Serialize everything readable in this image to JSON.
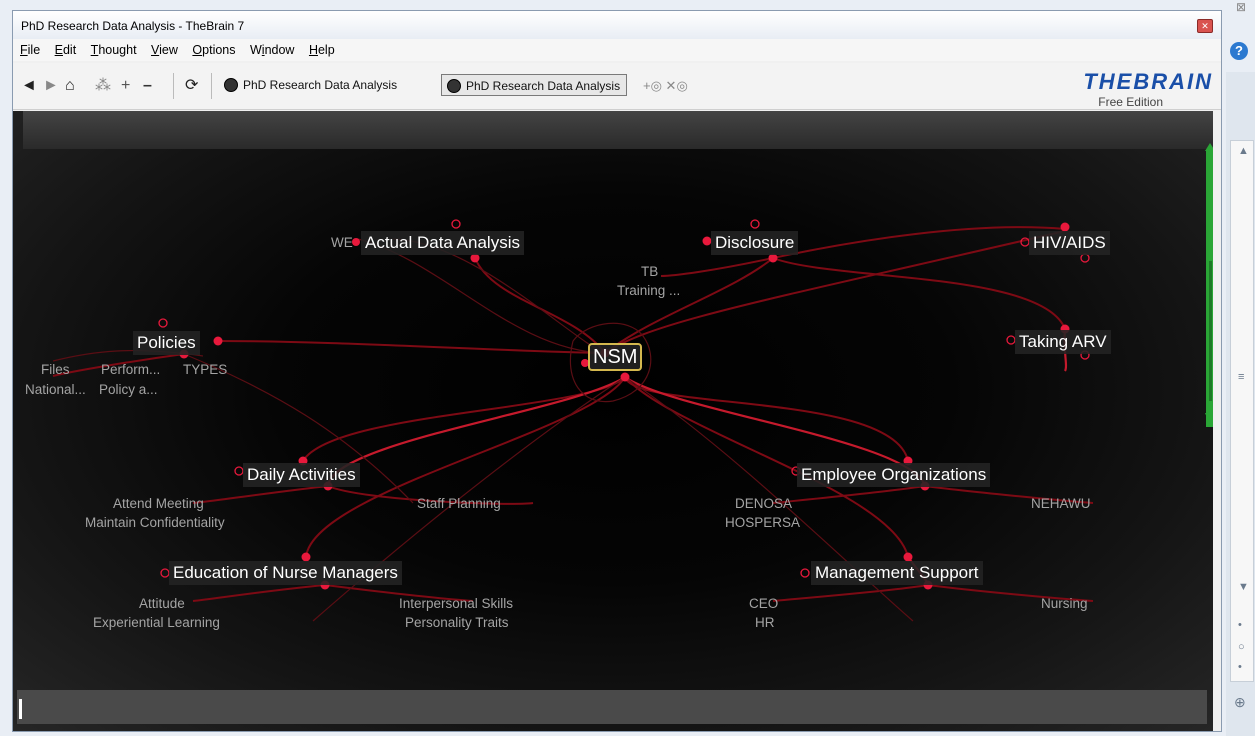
{
  "window": {
    "title": "PhD Research Data Analysis - TheBrain 7"
  },
  "menu": [
    "File",
    "Edit",
    "Thought",
    "View",
    "Options",
    "Window",
    "Help"
  ],
  "menu_accel": [
    "F",
    "E",
    "T",
    "V",
    "O",
    "i",
    "H"
  ],
  "toolbar": {
    "back": "◄",
    "forward": "►",
    "home": "⌂",
    "tab1": "PhD Research Data Analysis",
    "tab2": "PhD Research Data Analysis",
    "extras": "+◎ ✕◎"
  },
  "brand": {
    "logo": "THEBRAIN",
    "edition": "Free Edition"
  },
  "colors": {
    "link": "#8b0000",
    "bright_link": "#cc1122",
    "node_dot": "#e8193c",
    "center_border": "#d4b84e"
  },
  "center": {
    "label": "NSM"
  },
  "thoughts": {
    "actual": {
      "label": "Actual Data Analysis",
      "children": [
        "WE"
      ]
    },
    "disclosure": {
      "label": "Disclosure",
      "children": [
        "TB",
        "Training ..."
      ]
    },
    "hiv": {
      "label": "HIV/AIDS"
    },
    "policies": {
      "label": "Policies",
      "children": [
        "Files",
        "Perform...",
        "TYPES",
        "National...",
        "Policy a..."
      ]
    },
    "arv": {
      "label": "Taking ARV"
    },
    "daily": {
      "label": "Daily Activities",
      "children": [
        "Attend Meeting",
        "Maintain Confidentiality",
        "Staff Planning"
      ]
    },
    "employee": {
      "label": "Employee Organizations",
      "children": [
        "DENOSA",
        "HOSPERSA",
        "NEHAWU"
      ]
    },
    "education": {
      "label": "Education of Nurse Managers",
      "children": [
        "Attitude",
        "Experiential Learning",
        "Interpersonal Skills",
        "Personality Traits"
      ]
    },
    "management": {
      "label": "Management Support",
      "children": [
        "CEO",
        "HR",
        "Nursing"
      ]
    }
  },
  "side_icons": {
    "help": "?"
  }
}
